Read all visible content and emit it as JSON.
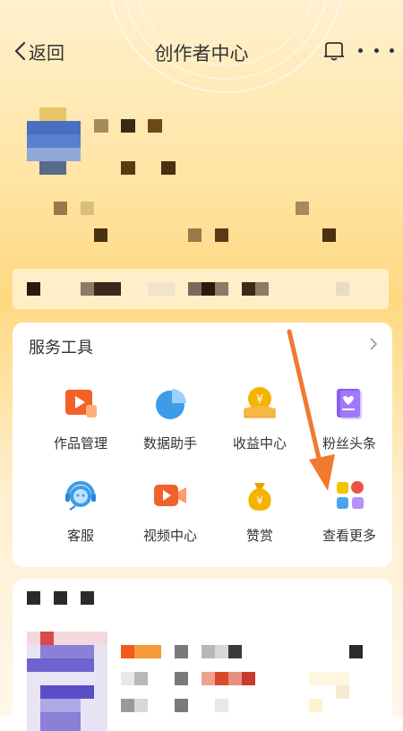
{
  "header": {
    "back_label": "返回",
    "title": "创作者中心"
  },
  "colors": {
    "accent_orange": "#f5792a",
    "text_primary": "#333333",
    "annotation_arrow": "#f07a2f"
  },
  "services": {
    "title": "服务工具",
    "tools": [
      {
        "label": "作品管理",
        "icon": "works-management-icon"
      },
      {
        "label": "数据助手",
        "icon": "data-assistant-icon"
      },
      {
        "label": "收益中心",
        "icon": "earnings-center-icon"
      },
      {
        "label": "粉丝头条",
        "icon": "fans-headline-icon"
      },
      {
        "label": "客服",
        "icon": "customer-service-icon"
      },
      {
        "label": "视频中心",
        "icon": "video-center-icon"
      },
      {
        "label": "赞赏",
        "icon": "tipping-icon"
      },
      {
        "label": "查看更多",
        "icon": "view-more-icon"
      }
    ]
  }
}
